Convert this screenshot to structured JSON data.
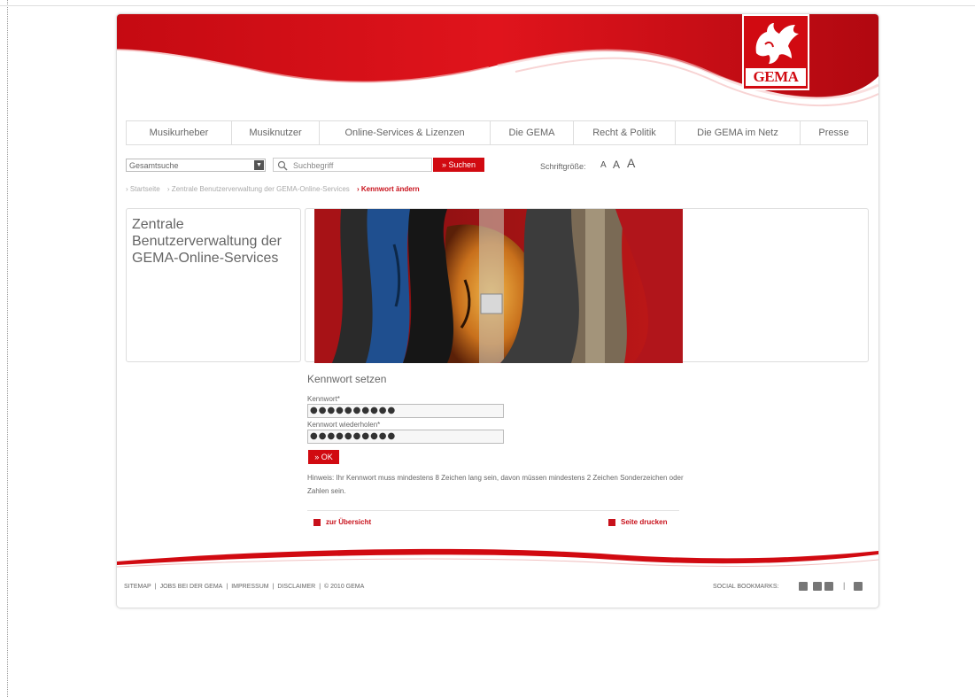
{
  "brand": {
    "logo_text": "GEMA",
    "accent": "#d10a11"
  },
  "nav": {
    "items": [
      "Musikurheber",
      "Musiknutzer",
      "Online-Services & Lizenzen",
      "Die GEMA",
      "Recht & Politik",
      "Die GEMA im Netz",
      "Presse"
    ]
  },
  "search": {
    "scope_value": "Gesamtsuche",
    "placeholder": "Suchbegriff",
    "button_label": "» Suchen"
  },
  "fontsize": {
    "label": "Schriftgröße:",
    "small": "A",
    "medium": "A",
    "large": "A"
  },
  "breadcrumb": {
    "items": [
      "› Startseite",
      "› Zentrale Benutzerverwaltung der GEMA-Online-Services"
    ],
    "current": "› Kennwort ändern"
  },
  "sidebar": {
    "title": "Zentrale Benutzerverwaltung der GEMA-Online-Services"
  },
  "form": {
    "title": "Kennwort setzen",
    "password_label": "Kennwort*",
    "password_value": "●●●●●●●●●●",
    "repeat_label": "Kennwort wiederholen*",
    "repeat_value": "●●●●●●●●●●",
    "ok_label": "» OK",
    "hint": "Hinweis: Ihr Kennwort muss mindestens 8 Zeichen lang sein, davon müssen mindestens 2 Zeichen Sonderzeichen oder Zahlen sein."
  },
  "links": {
    "back": "zur Übersicht",
    "print": "Seite drucken"
  },
  "footer": {
    "sitemap": "SITEMAP",
    "jobs": "JOBS BEI DER GEMA",
    "impressum": "IMPRESSUM",
    "disclaimer": "DISCLAIMER",
    "copyright": "© 2010 GEMA",
    "separator": "|",
    "social_label": "SOCIAL BOOKMARKS:"
  }
}
